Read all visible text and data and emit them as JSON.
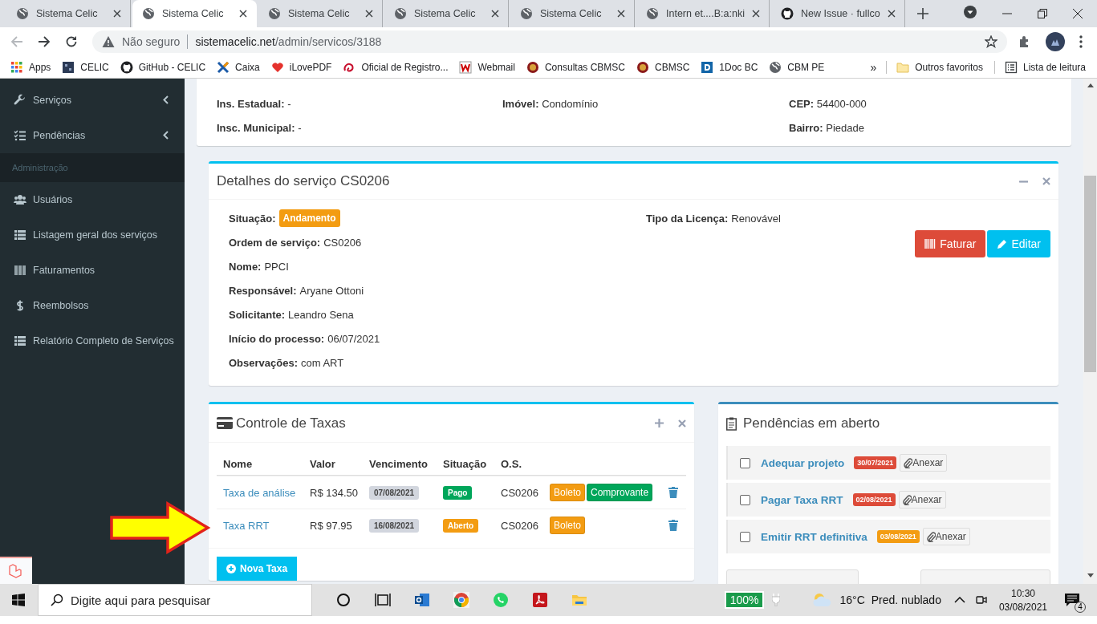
{
  "browser": {
    "tabs": [
      {
        "title": "Sistema Celic",
        "selected": false
      },
      {
        "title": "Sistema Celic",
        "selected": true
      },
      {
        "title": "Sistema Celic",
        "selected": false
      },
      {
        "title": "Sistema Celic",
        "selected": false
      },
      {
        "title": "Sistema Celic",
        "selected": false
      },
      {
        "title": "Intern et....B:a:nki",
        "selected": false
      },
      {
        "title": "New Issue · fullco",
        "selected": false
      }
    ],
    "security": "Não seguro",
    "url_host": "sistemacelic.net",
    "url_path": "/admin/servicos/3188",
    "bookmarks": [
      "Apps",
      "CELIC",
      "GitHub - CELIC",
      "Caixa",
      "iLovePDF",
      "Oficial de Registro...",
      "Webmail",
      "Consultas CBMSC",
      "CBMSC",
      "1Doc BC",
      "CBM PE"
    ],
    "more": "»",
    "other_bookmarks": "Outros favoritos",
    "reading_list": "Lista de leitura"
  },
  "sidebar": {
    "items": [
      {
        "kind": "link",
        "label": "Serviços",
        "collapsible": true
      },
      {
        "kind": "link",
        "label": "Pendências",
        "collapsible": true
      },
      {
        "kind": "header",
        "label": "Administração"
      },
      {
        "kind": "link",
        "label": "Usuários",
        "collapsible": false
      },
      {
        "kind": "link",
        "label": "Listagem geral dos serviços",
        "collapsible": false
      },
      {
        "kind": "link",
        "label": "Faturamentos",
        "collapsible": false
      },
      {
        "kind": "link",
        "label": "Reembolsos",
        "collapsible": false
      },
      {
        "kind": "link",
        "label": "Relatório Completo de Serviços",
        "collapsible": false
      }
    ]
  },
  "info_card": {
    "rows": [
      {
        "left": {
          "label": "Ins. Estadual:",
          "value": "-"
        },
        "middle": {
          "label": "Imóvel:",
          "value": "Condomínio"
        },
        "right": {
          "label": "CEP:",
          "value": "54400-000"
        }
      },
      {
        "left": {
          "label": "Insc. Municipal:",
          "value": "-"
        },
        "right": {
          "label": "Bairro:",
          "value": "Piedade"
        }
      }
    ]
  },
  "details": {
    "title": "Detalhes do serviço CS0206",
    "left": [
      {
        "label": "Situação:",
        "value": "Andamento",
        "kind": "badge",
        "color": "#f39c12"
      },
      {
        "label": "Ordem de serviço:",
        "value": "CS0206",
        "kind": "text"
      },
      {
        "label": "Nome:",
        "value": "PPCI",
        "kind": "text"
      },
      {
        "label": "Responsável:",
        "value": "Aryane Ottoni",
        "kind": "text"
      },
      {
        "label": "Solicitante:",
        "value": "Leandro Sena",
        "kind": "text"
      },
      {
        "label": "Início do processo:",
        "value": "06/07/2021",
        "kind": "text"
      },
      {
        "label": "Observações:",
        "value": "com ART",
        "kind": "text"
      }
    ],
    "right": [
      {
        "label": "Tipo da Licença:",
        "value": "Renovável",
        "kind": "text"
      }
    ],
    "buttons": [
      {
        "label": "Faturar",
        "kind": "danger"
      },
      {
        "label": "Editar",
        "kind": "info"
      }
    ]
  },
  "taxes": {
    "title": "Controle de Taxas",
    "columns": [
      "Nome",
      "Valor",
      "Vencimento",
      "Situação",
      "O.S."
    ],
    "rows": [
      {
        "name": "Taxa de análise",
        "value": "R$ 134.50",
        "due": "07/08/2021",
        "status": {
          "label": "Pago",
          "color": "#00a65a"
        },
        "os": "CS0206",
        "actions": [
          {
            "label": "Boleto",
            "color": "#f39c12"
          },
          {
            "label": "Comprovante",
            "color": "#00a65a"
          }
        ]
      },
      {
        "name": "Taxa RRT",
        "value": "R$ 97.95",
        "due": "16/08/2021",
        "status": {
          "label": "Aberto",
          "color": "#f39c12"
        },
        "os": "CS0206",
        "actions": [
          {
            "label": "Boleto",
            "color": "#f39c12"
          }
        ]
      }
    ],
    "new_button": "Nova Taxa"
  },
  "pending": {
    "title": "Pendências em aberto",
    "items": [
      {
        "label": "Adequar projeto",
        "checked": false,
        "date": "30/07/2021",
        "color": "#dd4b39",
        "attach": "Anexar"
      },
      {
        "label": "Pagar Taxa RRT",
        "checked": false,
        "date": "02/08/2021",
        "color": "#dd4b39",
        "attach": "Anexar"
      },
      {
        "label": "Emitir RRT definitiva",
        "checked": false,
        "date": "03/08/2021",
        "color": "#f39c12",
        "attach": "Anexar"
      }
    ]
  },
  "taskbar": {
    "search_placeholder": "Digite aqui para pesquisar",
    "battery": "100%",
    "temperature": "16°C",
    "weather": "Pred. nublado",
    "time": "10:30",
    "date": "03/08/2021",
    "notifications": "4"
  }
}
